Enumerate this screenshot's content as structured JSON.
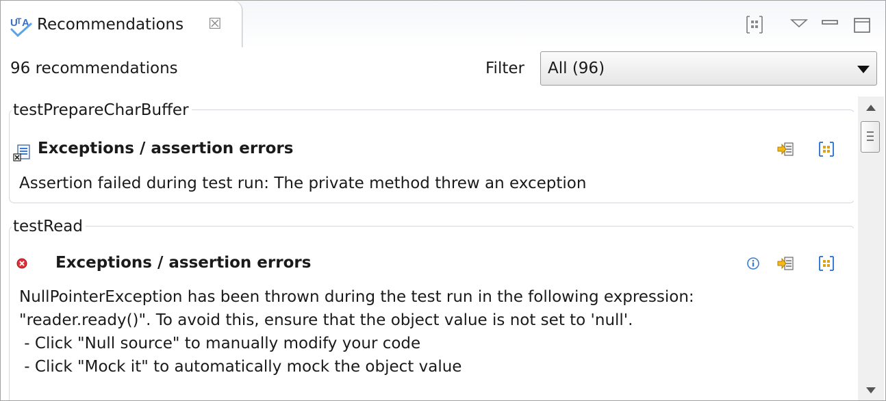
{
  "tab": {
    "icon": "uta-logo-icon",
    "title": "Recommendations",
    "close_glyph": "☒"
  },
  "toolbar": {
    "icons": [
      "layout-grid-icon",
      "view-menu-icon",
      "minimize-icon",
      "maximize-icon"
    ]
  },
  "header": {
    "count": "96 recommendations",
    "filter_label": "Filter",
    "filter_value": "All (96)"
  },
  "groups": [
    {
      "test": "testPrepareCharBuffer",
      "icon": "assertion-error-icon",
      "title": "Exceptions / assertion errors",
      "lines": [
        "Assertion failed during test run: The private method threw an exception"
      ],
      "actions": [
        "go-to-source-icon",
        "show-details-icon"
      ]
    },
    {
      "test": "testRead",
      "icon": "error-red-x-icon",
      "title": "Exceptions / assertion errors",
      "lines": [
        "NullPointerException has been thrown during the test run in the following expression:",
        "\"reader.ready()\". To avoid this, ensure that the object value is not set to 'null'.",
        " - Click \"Null source\" to manually modify your code",
        " - Click \"Mock it\" to automatically mock the object value"
      ],
      "actions": [
        "info-icon",
        "go-to-source-icon",
        "show-details-icon"
      ]
    }
  ],
  "colors": {
    "accent": "#3a7bd5",
    "error": "#e0303a",
    "yellow": "#f2b81c",
    "border": "#d3d6da"
  }
}
